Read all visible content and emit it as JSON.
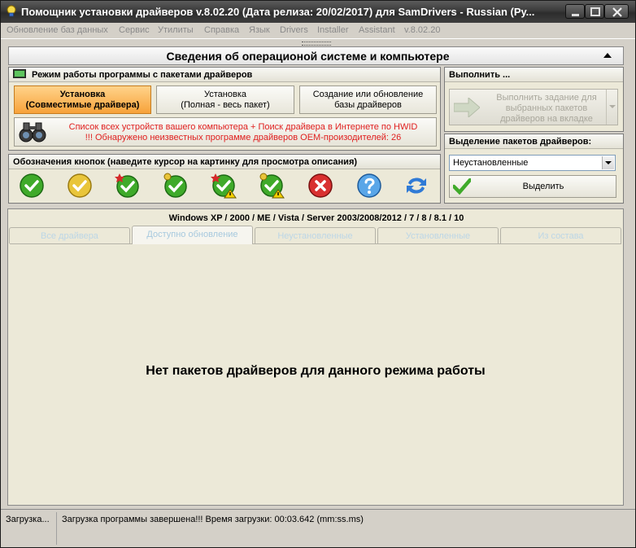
{
  "window": {
    "title": "Помощник установки драйверов v.8.02.20 (Дата релиза: 20/02/2017) для SamDrivers - Russian (Ру...",
    "title_icon": "app-bulb-icon"
  },
  "menu": {
    "items": [
      "Обновление баз данных",
      "Сервис",
      "Утилиты",
      "Справка",
      "Язык",
      "Drivers",
      "Installer",
      "Assistant",
      "v.8.02.20"
    ]
  },
  "header": {
    "title": "Сведения об операционой системе и компьютере"
  },
  "mode_panel": {
    "title": "Режим работы программы с пакетами драйверов",
    "buttons": [
      {
        "line1": "Установка",
        "line2": "(Совместимые драйвера)",
        "active": true
      },
      {
        "line1": "Установка",
        "line2": "(Полная - весь пакет)",
        "active": false
      },
      {
        "line1": "Создание или обновление",
        "line2": "базы драйверов",
        "active": false
      }
    ],
    "hwid_line1": "Список всех устройств вашего компьютера + Поиск драйвера в Интернете по HWID",
    "hwid_line2": "!!! Обнаружено неизвестных программе драйверов OEM-произодителей: 26"
  },
  "legend_panel": {
    "title": "Обозначения кнопок (наведите курсор на картинку для просмотра описания)",
    "icons": [
      "green-check-icon",
      "yellow-check-icon",
      "green-check-star-icon",
      "green-check-pin-icon",
      "green-check-star-warning-icon",
      "green-check-pin-warning-icon",
      "red-cross-icon",
      "blue-question-icon",
      "blue-refresh-arrows-icon"
    ]
  },
  "execute_panel": {
    "title": "Выполнить ...",
    "button_line1": "Выполнить задание для",
    "button_line2": "выбранных пакетов",
    "button_line3": "драйверов на вкладке"
  },
  "selection_panel": {
    "title": "Выделение пакетов драйверов:",
    "select_value": "Неустановленные",
    "select_button": "Выделить"
  },
  "tabs": {
    "os_line": "Windows XP / 2000 / ME / Vista / Server 2003/2008/2012 / 7 / 8 / 8.1 / 10",
    "items": [
      "Все драйвера",
      "Доступно обновление",
      "Неустановленные",
      "Установленные",
      "Из состава"
    ],
    "active_index": 1,
    "empty_message": "Нет пакетов драйверов для данного режима работы"
  },
  "status": {
    "left": "Загрузка...",
    "right": "Загрузка программы завершена!!! Время загрузки: 00:03.642 (mm:ss.ms)"
  },
  "colors": {
    "active_mode_button": "#f7a23a",
    "hwid_text": "#e02020",
    "titlebar": "#3a3a3a"
  }
}
